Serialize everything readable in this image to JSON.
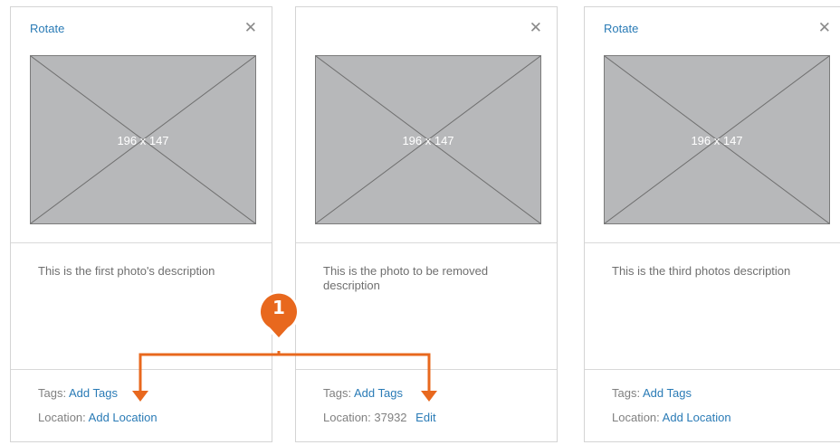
{
  "cards": [
    {
      "rotate_label": "Rotate",
      "close_glyph": "✕",
      "placeholder_text": "196 x 147",
      "description": "This is the first photo's description",
      "tags_label": "Tags:",
      "tags_link": "Add Tags",
      "location_label": "Location:",
      "location_value": "",
      "location_link": "Add Location"
    },
    {
      "rotate_label": "",
      "close_glyph": "✕",
      "placeholder_text": "196 x 147",
      "description": "This is the photo to be removed description",
      "tags_label": "Tags:",
      "tags_link": "Add Tags",
      "location_label": "Location:",
      "location_value": "37932",
      "location_link": "Edit"
    },
    {
      "rotate_label": "Rotate",
      "close_glyph": "✕",
      "placeholder_text": "196 x 147",
      "description": "This is the third photos description",
      "tags_label": "Tags:",
      "tags_link": "Add Tags",
      "location_label": "Location:",
      "location_value": "",
      "location_link": "Add Location"
    }
  ],
  "annotation": {
    "number": "1",
    "color": "#e8681e"
  },
  "colors": {
    "link": "#2a7bb6",
    "placeholder": "#b7b8ba",
    "border": "#d4d4d4"
  }
}
